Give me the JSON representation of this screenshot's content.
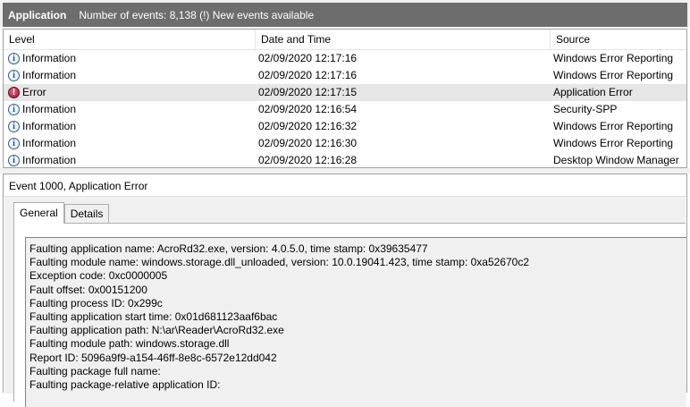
{
  "header": {
    "title": "Application",
    "info": "Number of events: 8,138 (!) New events available"
  },
  "table": {
    "columns": {
      "level": "Level",
      "date": "Date and Time",
      "source": "Source"
    },
    "rows": [
      {
        "icon": "information-icon",
        "level": "Information",
        "date": "02/09/2020 12:17:16",
        "source": "Windows Error Reporting"
      },
      {
        "icon": "information-icon",
        "level": "Information",
        "date": "02/09/2020 12:17:16",
        "source": "Windows Error Reporting"
      },
      {
        "icon": "error-icon",
        "level": "Error",
        "date": "02/09/2020 12:17:15",
        "source": "Application Error"
      },
      {
        "icon": "information-icon",
        "level": "Information",
        "date": "02/09/2020 12:16:54",
        "source": "Security-SPP"
      },
      {
        "icon": "information-icon",
        "level": "Information",
        "date": "02/09/2020 12:16:32",
        "source": "Windows Error Reporting"
      },
      {
        "icon": "information-icon",
        "level": "Information",
        "date": "02/09/2020 12:16:30",
        "source": "Windows Error Reporting"
      },
      {
        "icon": "information-icon",
        "level": "Information",
        "date": "02/09/2020 12:16:28",
        "source": "Desktop Window Manager"
      }
    ]
  },
  "detail": {
    "title": "Event 1000, Application Error",
    "tabs": {
      "general": "General",
      "details": "Details"
    },
    "description": [
      "Faulting application name: AcroRd32.exe, version: 4.0.5.0, time stamp: 0x39635477",
      "Faulting module name: windows.storage.dll_unloaded, version: 10.0.19041.423, time stamp: 0xa52670c2",
      "Exception code: 0xc0000005",
      "Fault offset: 0x00151200",
      "Faulting process ID: 0x299c",
      "Faulting application start time: 0x01d681123aaf6bac",
      "Faulting application path: N:\\ar\\Reader\\AcroRd32.exe",
      "Faulting module path: windows.storage.dll",
      "Report ID: 5096a9f9-a154-46ff-8e8c-6572e12dd042",
      "Faulting package full name:",
      "Faulting package-relative application ID:"
    ]
  },
  "colors": {
    "header_bg": "#6d6d6d",
    "selected_row": "#e6e6e6",
    "info_icon": "#2d5f9a",
    "error_icon": "#8f1530"
  }
}
